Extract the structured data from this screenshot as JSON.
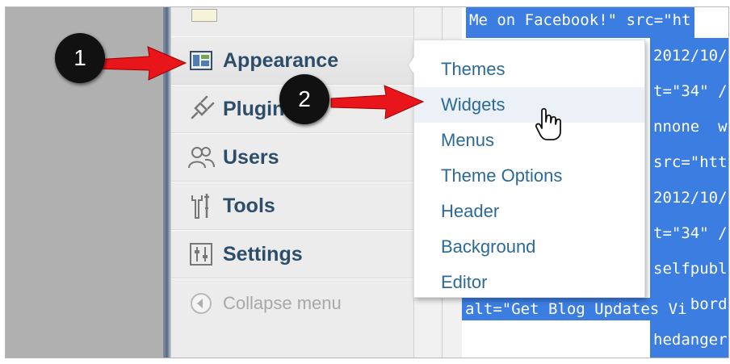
{
  "code_lines": [
    "Me on Facebook!\" src=\"ht",
    "2012/10/",
    "t=\"34\" /",
    "nnone  w",
    "src=\"htt",
    "2012/10/",
    "t=\"34\" /",
    "selfpubl",
    "le=\"bord",
    "hedanger",
    "alt=\"Get Blog Updates Vi"
  ],
  "sidebar": {
    "items": [
      {
        "label": "Appearance",
        "icon": "appearance-icon"
      },
      {
        "label": "Plugins",
        "icon": "plugins-icon"
      },
      {
        "label": "Users",
        "icon": "users-icon"
      },
      {
        "label": "Tools",
        "icon": "tools-icon"
      },
      {
        "label": "Settings",
        "icon": "settings-icon"
      },
      {
        "label": "Collapse menu",
        "icon": "collapse-icon"
      }
    ]
  },
  "flyout": {
    "items": [
      "Themes",
      "Widgets",
      "Menus",
      "Theme Options",
      "Header",
      "Background",
      "Editor"
    ],
    "hovered": "Widgets"
  },
  "callouts": {
    "one": "1",
    "two": "2"
  },
  "colors": {
    "arrow": "#e8151b",
    "link": "#2b6a97",
    "selection": "#3b7de0"
  }
}
